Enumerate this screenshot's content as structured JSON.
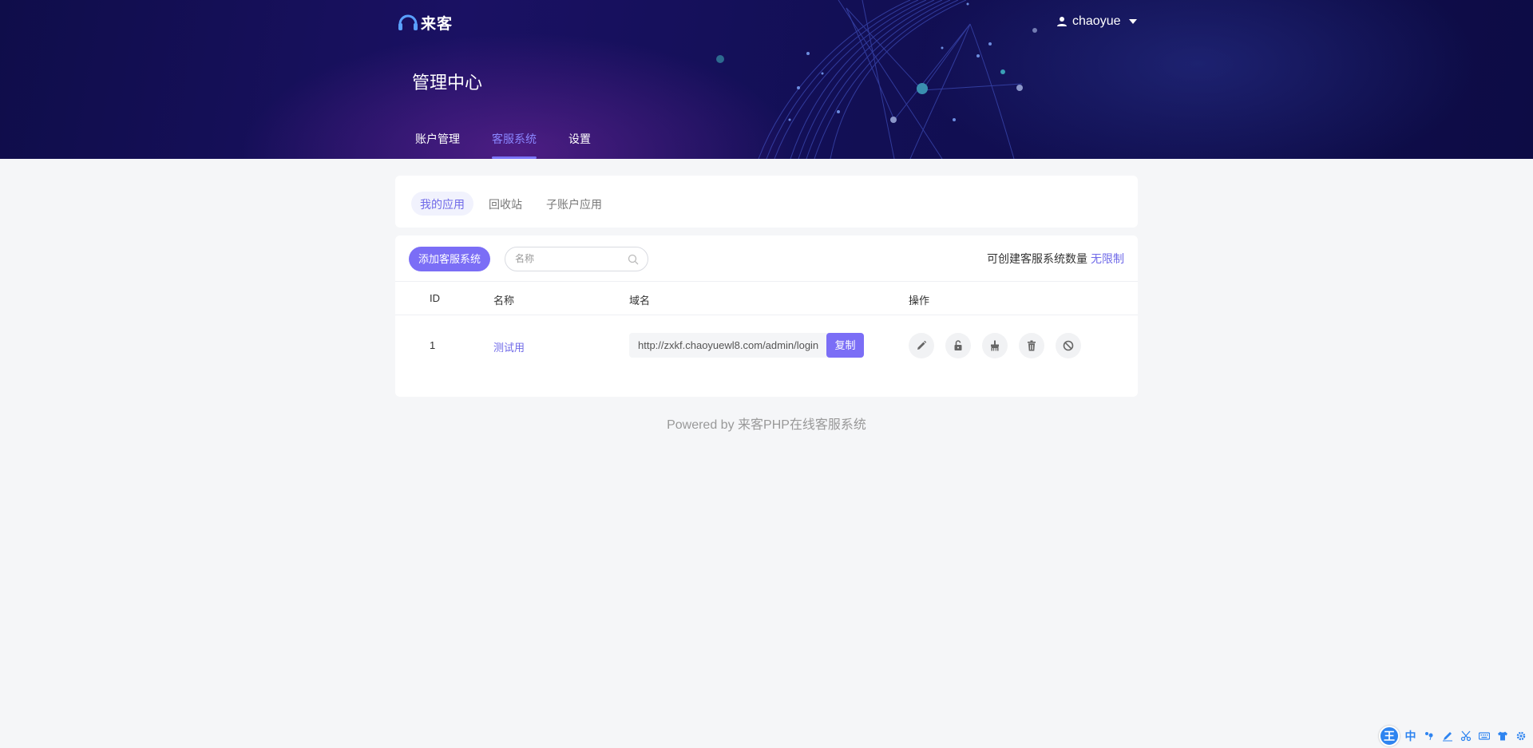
{
  "header": {
    "logo_text": "来客",
    "user_name": "chaoyue",
    "page_title": "管理中心",
    "nav": [
      {
        "label": "账户管理",
        "active": false
      },
      {
        "label": "客服系统",
        "active": true
      },
      {
        "label": "设置",
        "active": false
      }
    ]
  },
  "subtabs": [
    {
      "label": "我的应用",
      "active": true
    },
    {
      "label": "回收站",
      "active": false
    },
    {
      "label": "子账户应用",
      "active": false
    }
  ],
  "toolbar": {
    "add_label": "添加客服系统",
    "search_placeholder": "名称",
    "quota_label": "可创建客服系统数量",
    "quota_value": "无限制"
  },
  "table": {
    "columns": [
      "ID",
      "名称",
      "域名",
      "操作"
    ],
    "rows": [
      {
        "id": "1",
        "name": "测试用",
        "domain": "http://zxkf.chaoyuewl8.com/admin/login",
        "copy_label": "复制",
        "actions": [
          "edit-icon",
          "unlock-icon",
          "brush-icon",
          "trash-icon",
          "ban-icon"
        ]
      }
    ]
  },
  "footer": {
    "text": "Powered by 来客PHP在线客服系统"
  },
  "ime": {
    "logo": "王",
    "lang": "中",
    "items": [
      "punctuation-icon",
      "pen-icon",
      "scissors-icon",
      "keyboard-icon",
      "shirt-icon",
      "settings-icon"
    ]
  },
  "colors": {
    "accent": "#7b6ef6",
    "header_bg": "#120f55",
    "link": "#6f69e8",
    "ime_blue": "#2e84f0"
  }
}
